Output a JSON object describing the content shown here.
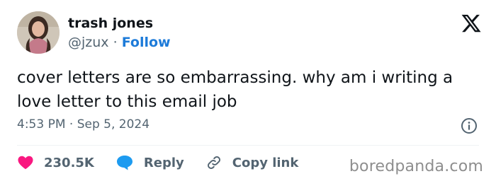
{
  "author": {
    "name": "trash jones",
    "handle": "@jzux",
    "separator": "·",
    "follow_label": "Follow"
  },
  "tweet": {
    "text": "cover letters are so embarrassing. why am i writing a love letter to this email job",
    "timestamp": "4:53 PM · Sep 5, 2024"
  },
  "actions": {
    "likes": "230.5K",
    "reply_label": "Reply",
    "copy_link_label": "Copy link"
  },
  "watermark": "boredpanda.com",
  "icons": {
    "platform": "x-logo-icon",
    "info": "info-icon",
    "like": "heart-icon",
    "reply": "reply-bubble-icon",
    "copy": "link-icon"
  },
  "colors": {
    "like": "#f91880",
    "reply": "#1d9bf0",
    "follow": "#1d7bd9",
    "muted": "#536471"
  }
}
